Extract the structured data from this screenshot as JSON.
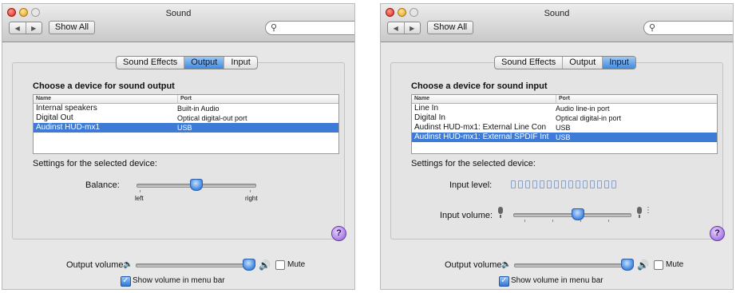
{
  "windows": [
    {
      "title": "Sound",
      "toolbar": {
        "back": "◀",
        "forward": "▶",
        "show_all": "Show All",
        "search_placeholder": ""
      },
      "tabs": [
        {
          "label": "Sound Effects",
          "active": false
        },
        {
          "label": "Output",
          "active": true
        },
        {
          "label": "Input",
          "active": false
        }
      ],
      "heading": "Choose a device for sound output",
      "table": {
        "columns": [
          "Name",
          "Port"
        ],
        "rows": [
          {
            "name": "Internal speakers",
            "port": "Built-in Audio",
            "selected": false
          },
          {
            "name": "Digital Out",
            "port": "Optical digital-out port",
            "selected": false
          },
          {
            "name": "Audinst HUD-mx1",
            "port": "USB",
            "selected": true
          }
        ]
      },
      "settings_label": "Settings for the selected device:",
      "balance": {
        "label": "Balance:",
        "left": "left",
        "right": "right",
        "value": 0.5
      },
      "help": "?",
      "output_volume": {
        "label": "Output volume:",
        "value": 0.95,
        "mute_label": "Mute",
        "muted": false
      },
      "show_volume": {
        "label": "Show volume in menu bar",
        "checked": true
      }
    },
    {
      "title": "Sound",
      "toolbar": {
        "back": "◀",
        "forward": "▶",
        "show_all": "Show All",
        "search_placeholder": ""
      },
      "tabs": [
        {
          "label": "Sound Effects",
          "active": false
        },
        {
          "label": "Output",
          "active": false
        },
        {
          "label": "Input",
          "active": true
        }
      ],
      "heading": "Choose a device for sound input",
      "table": {
        "columns": [
          "Name",
          "Port"
        ],
        "rows": [
          {
            "name": "Line In",
            "port": "Audio line-in port",
            "selected": false
          },
          {
            "name": "Digital In",
            "port": "Optical digital-in port",
            "selected": false
          },
          {
            "name": "Audinst HUD-mx1: External Line Con",
            "port": "USB",
            "selected": false
          },
          {
            "name": "Audinst HUD-mx1: External SPDIF Int",
            "port": "USB",
            "selected": true
          }
        ]
      },
      "settings_label": "Settings for the selected device:",
      "input_level": {
        "label": "Input level:",
        "segments": 15,
        "lit": 0
      },
      "input_volume": {
        "label": "Input volume:",
        "value": 0.55
      },
      "help": "?",
      "output_volume": {
        "label": "Output volume:",
        "value": 0.95,
        "mute_label": "Mute",
        "muted": false
      },
      "show_volume": {
        "label": "Show volume in menu bar",
        "checked": true
      }
    }
  ]
}
